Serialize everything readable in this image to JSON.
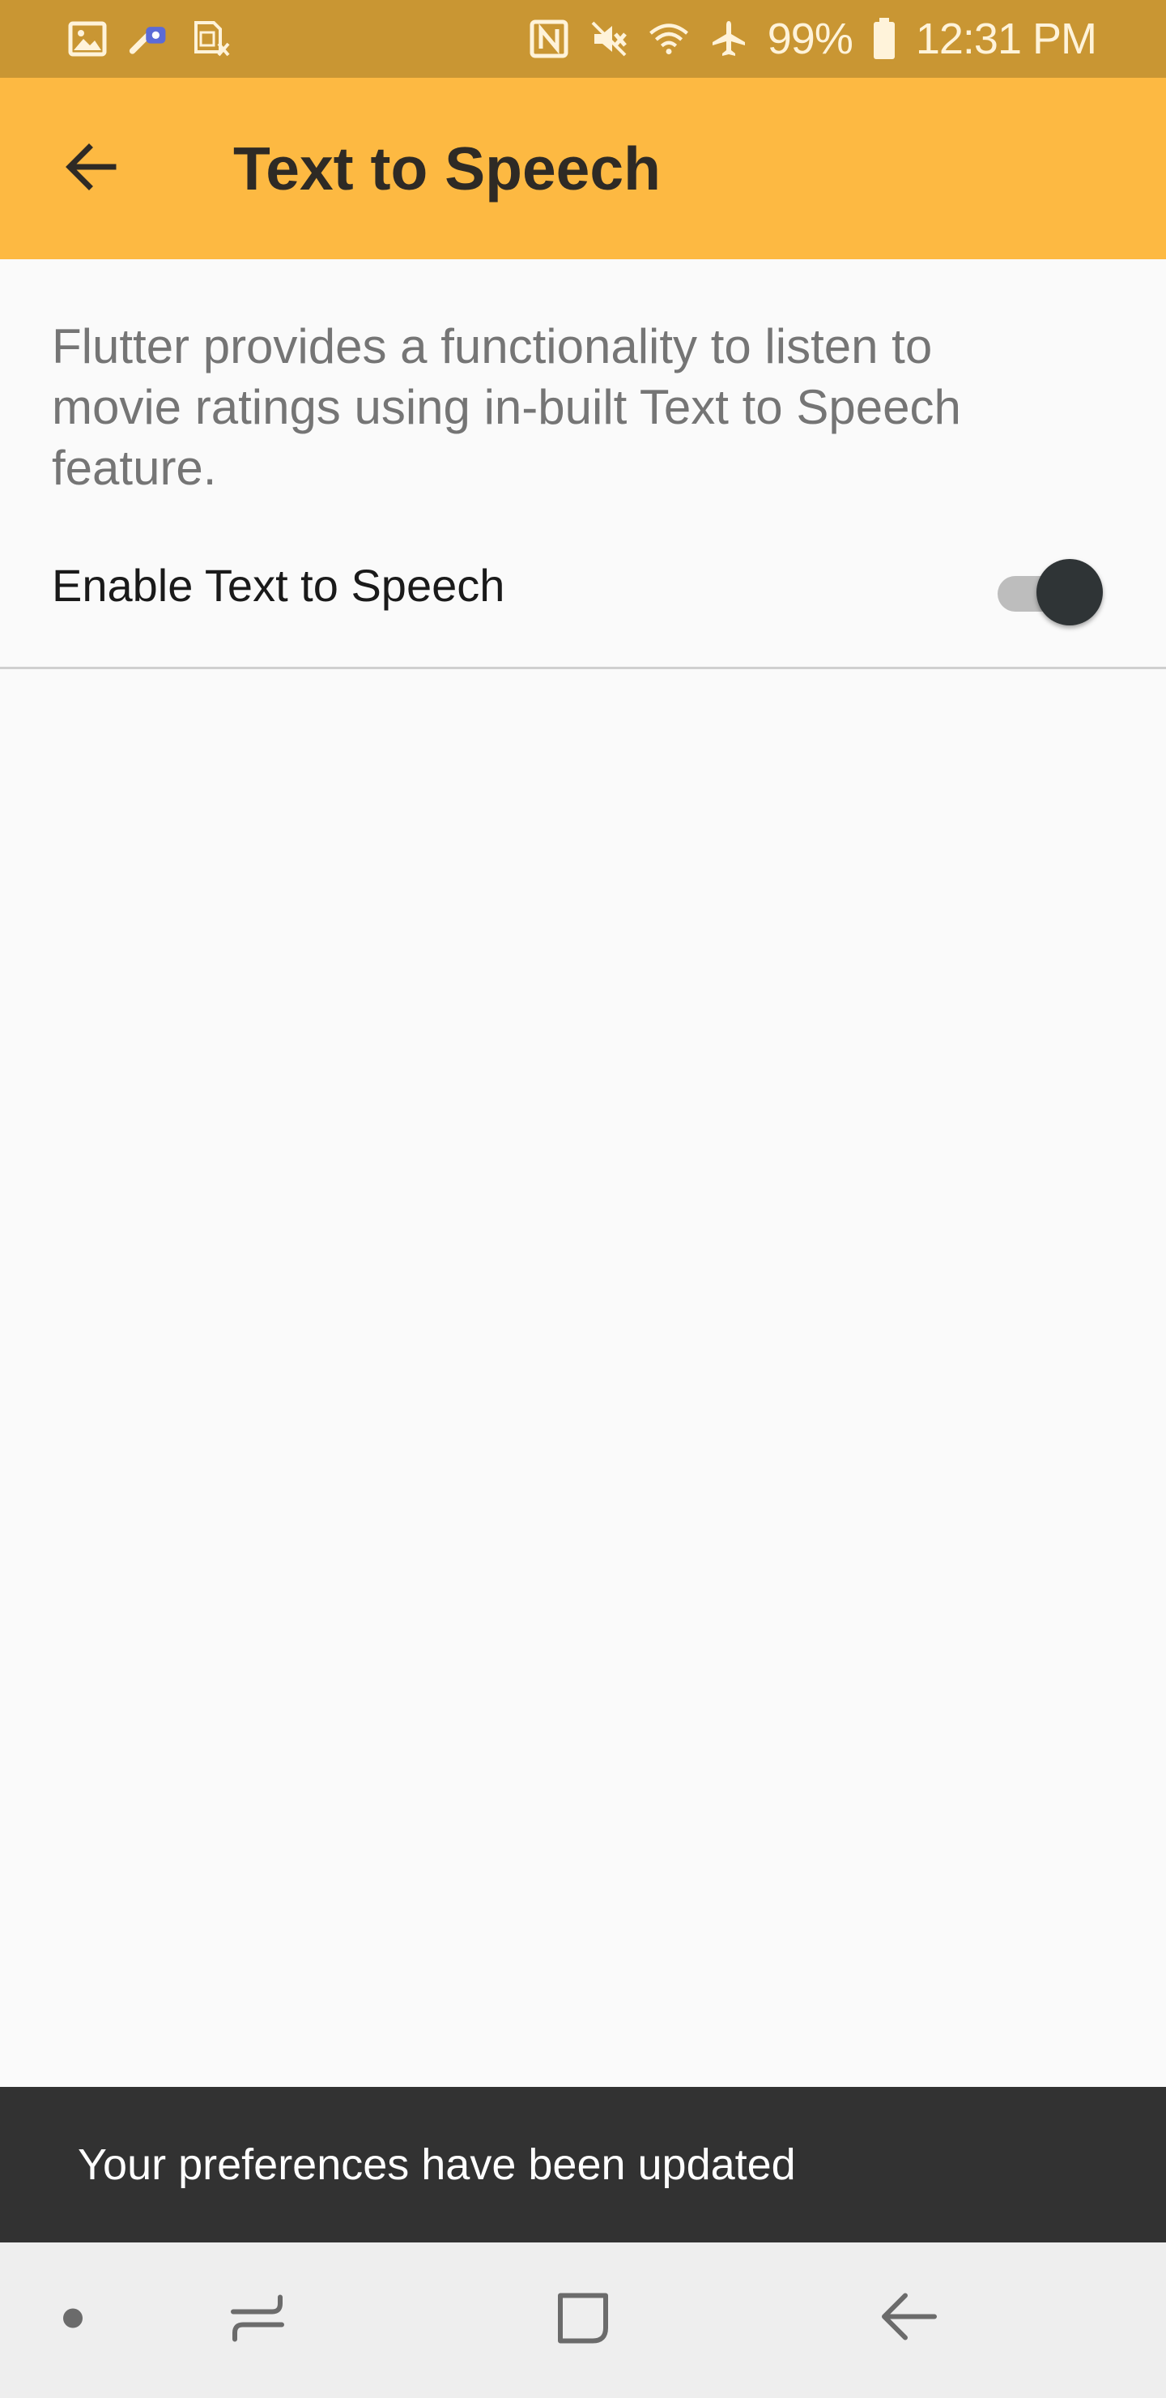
{
  "status_bar": {
    "battery": "99%",
    "time": "12:31 PM",
    "icons": [
      "gallery-icon",
      "app-notification-icon",
      "sim-card-icon",
      "nfc-icon",
      "mute-icon",
      "wifi-icon",
      "airplane-mode-icon",
      "battery-icon"
    ]
  },
  "app_bar": {
    "title": "Text to Speech",
    "back_icon": "arrow-back-icon",
    "background": "#FDB942"
  },
  "content": {
    "description": "Flutter provides a functionality to listen to movie ratings using in-built Text to Speech feature.",
    "setting": {
      "label": "Enable Text to Speech",
      "enabled": true
    }
  },
  "snackbar": {
    "message": "Your preferences have been updated"
  },
  "nav_bar": {
    "buttons": [
      "dot-icon",
      "recent-apps-icon",
      "home-icon",
      "back-icon"
    ]
  }
}
